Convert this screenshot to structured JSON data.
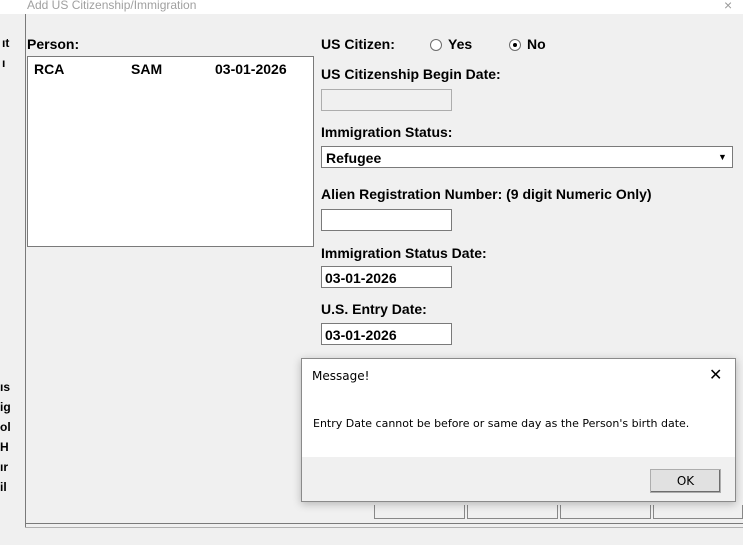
{
  "window": {
    "title": "Add US Citizenship/Immigration",
    "close_glyph": "×"
  },
  "person": {
    "label": "Person:",
    "rows": [
      {
        "last": "RCA",
        "first": "SAM",
        "dob": "03-01-2026"
      }
    ]
  },
  "citizen": {
    "label": "US Citizen:",
    "yes": "Yes",
    "no": "No",
    "selected": "No"
  },
  "citizenship_begin": {
    "label": "US Citizenship Begin Date:",
    "value": ""
  },
  "immigration_status": {
    "label": "Immigration Status:",
    "value": "Refugee"
  },
  "alien_reg": {
    "label": "Alien Registration Number:  (9 digit Numeric Only)",
    "value": ""
  },
  "immigration_status_date": {
    "label": "Immigration Status Date:",
    "value": "03-01-2026"
  },
  "entry_date": {
    "label": "U.S. Entry Date:",
    "value": "03-01-2026"
  },
  "dialog": {
    "title": "Message!",
    "close_glyph": "✕",
    "message": "Entry Date cannot be before or same day as the Person's birth date.",
    "ok_label": "OK"
  },
  "left_fragments": [
    "ıt",
    "ı",
    "ıs",
    "ig",
    "ol",
    "H",
    "ır",
    "il"
  ],
  "colors": {
    "background": "#f0f0f0",
    "field": "#ffffff",
    "border": "#7a7a7a"
  }
}
